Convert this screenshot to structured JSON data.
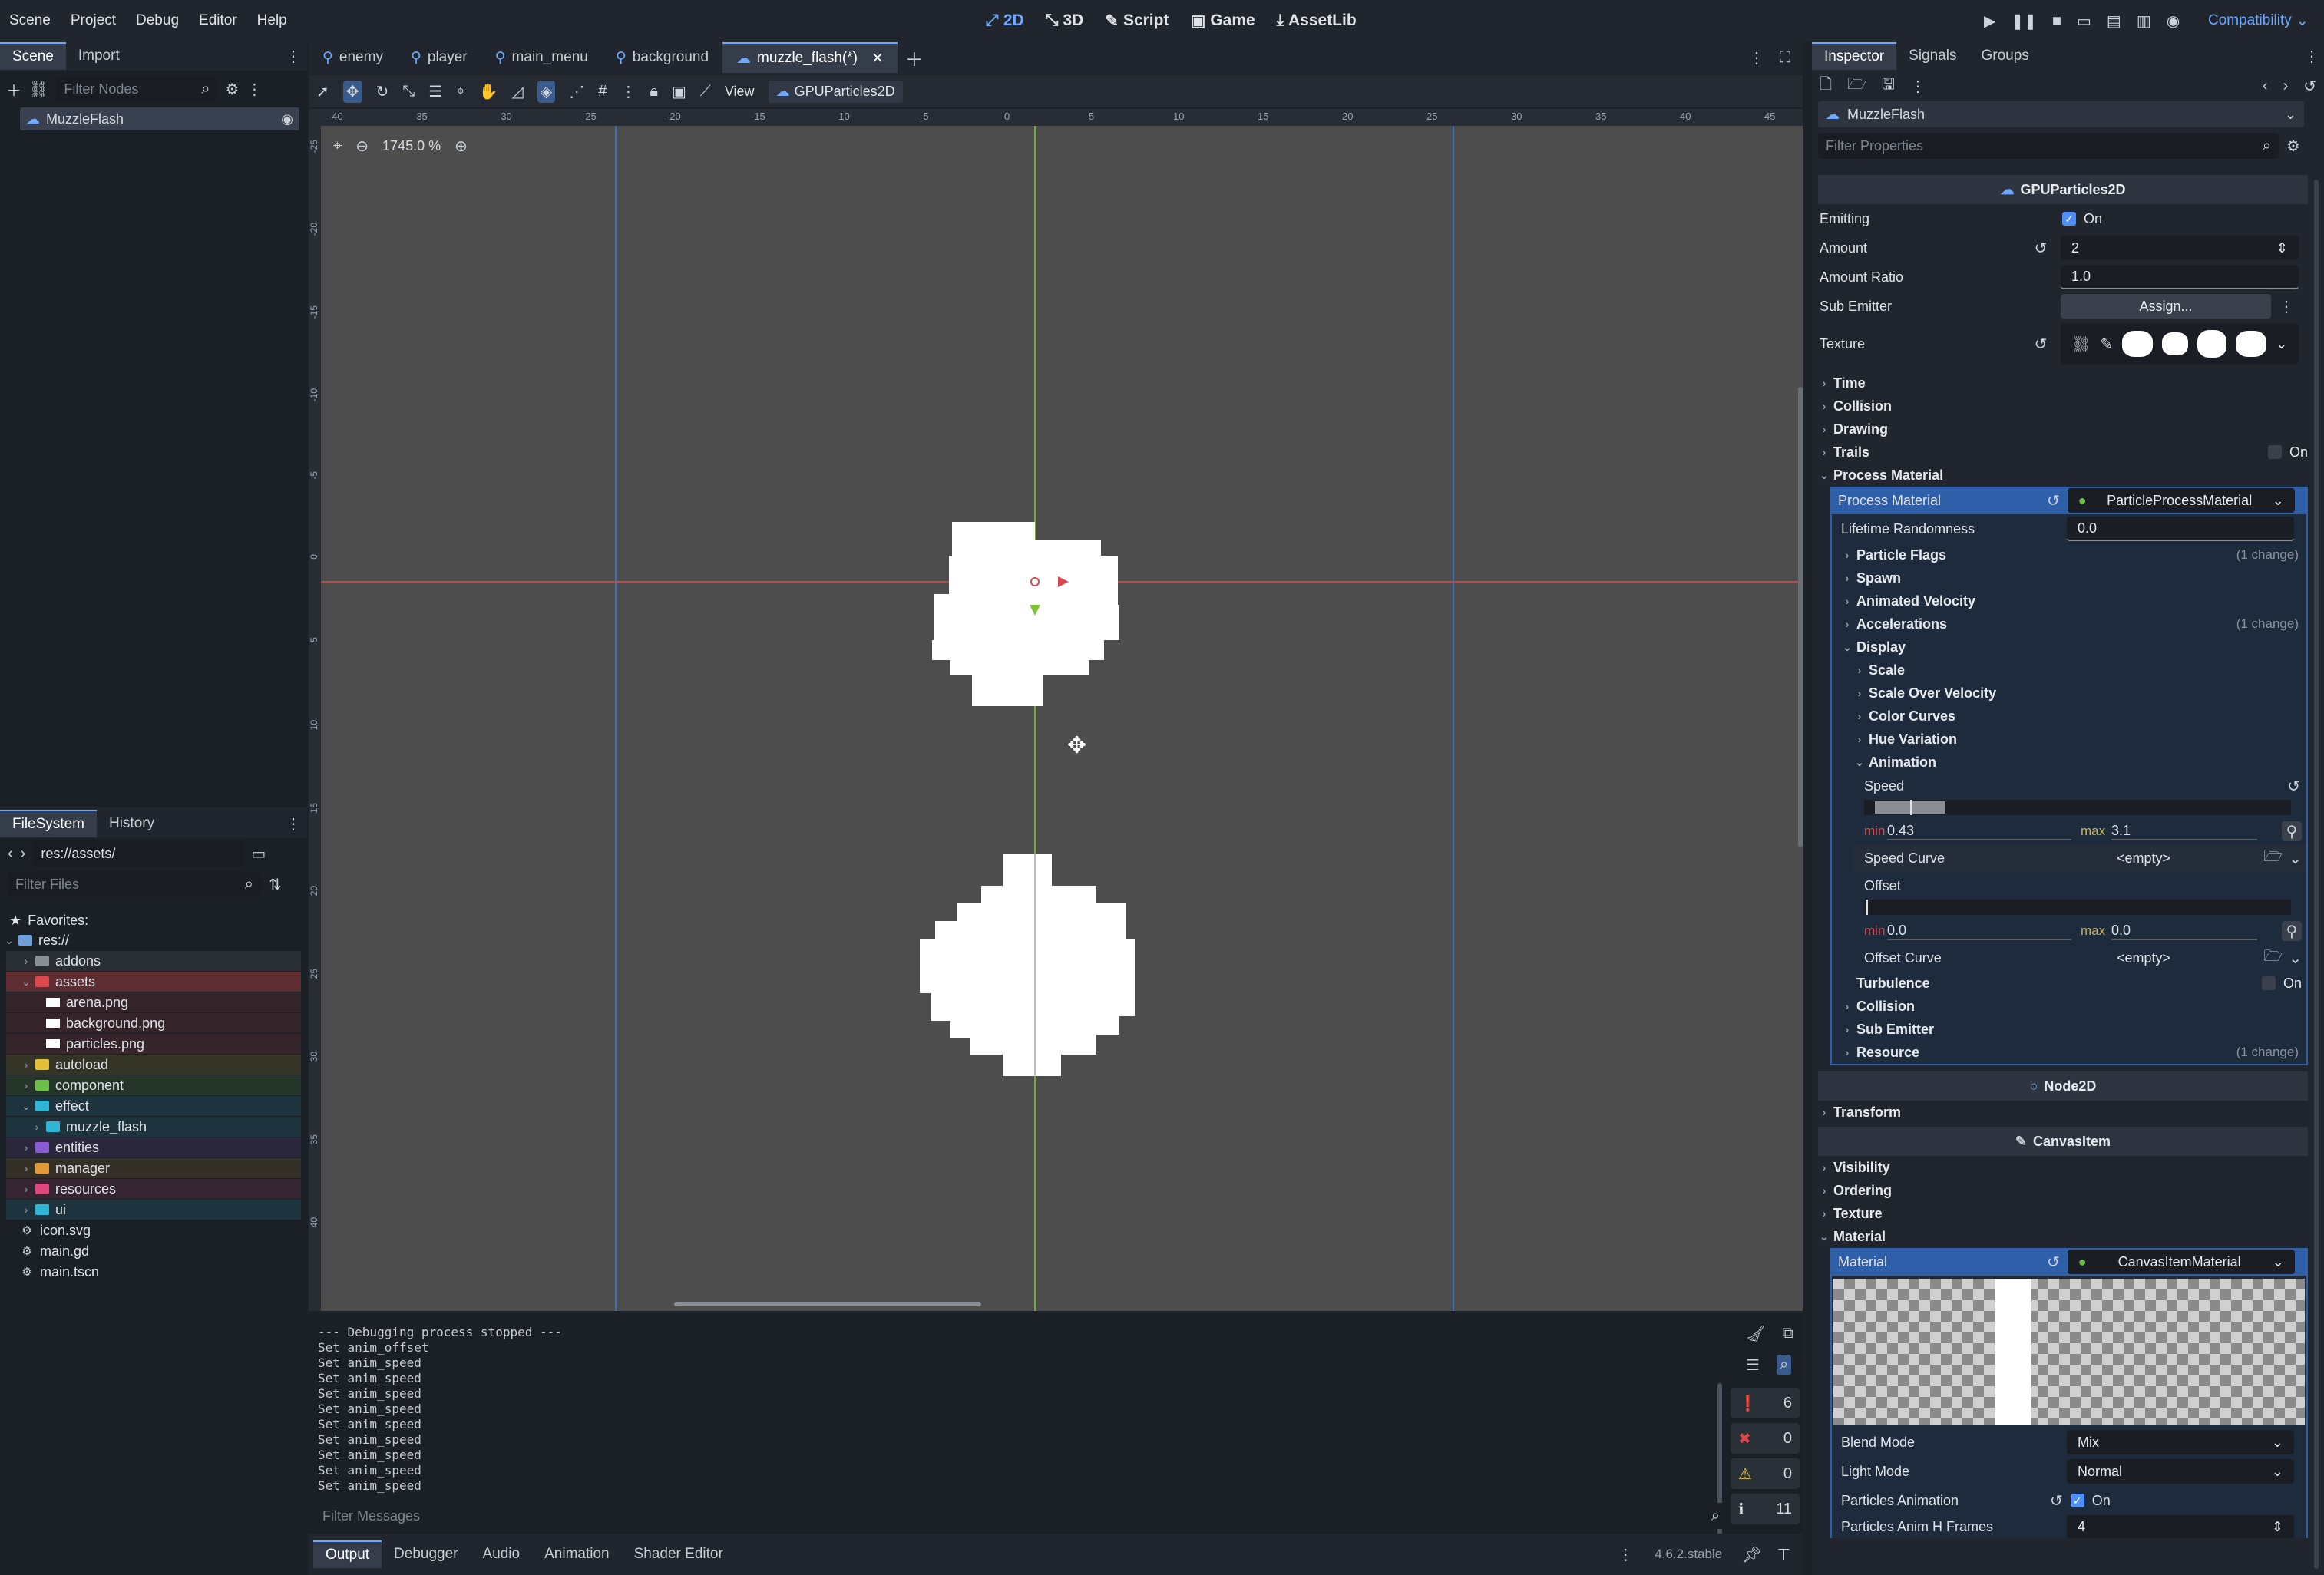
{
  "menu": [
    "Scene",
    "Project",
    "Debug",
    "Editor",
    "Help"
  ],
  "workspaces": [
    {
      "label": "2D",
      "active": true
    },
    {
      "label": "3D",
      "active": false
    },
    {
      "label": "Script",
      "active": false
    },
    {
      "label": "Game",
      "active": false
    },
    {
      "label": "AssetLib",
      "active": false
    }
  ],
  "renderer": "Compatibility",
  "scene_dock": {
    "tabs": [
      "Scene",
      "Import"
    ],
    "filter_placeholder": "Filter Nodes",
    "root_node": "MuzzleFlash"
  },
  "filesystem": {
    "tabs": [
      "FileSystem",
      "History"
    ],
    "path": "res://assets/",
    "filter_placeholder": "Filter Files",
    "favorites_label": "Favorites:",
    "root": "res://",
    "items": [
      {
        "name": "addons",
        "type": "folder",
        "color": "#8a8f96",
        "depth": 1,
        "expanded": false
      },
      {
        "name": "assets",
        "type": "folder",
        "color": "#e0474c",
        "depth": 1,
        "expanded": true,
        "selected": true
      },
      {
        "name": "arena.png",
        "type": "image",
        "depth": 2
      },
      {
        "name": "background.png",
        "type": "image",
        "depth": 2
      },
      {
        "name": "particles.png",
        "type": "image",
        "depth": 2
      },
      {
        "name": "autoload",
        "type": "folder",
        "color": "#e3c035",
        "depth": 1,
        "expanded": false
      },
      {
        "name": "component",
        "type": "folder",
        "color": "#6cc04a",
        "depth": 1,
        "expanded": false
      },
      {
        "name": "effect",
        "type": "folder",
        "color": "#2fb5d6",
        "depth": 1,
        "expanded": true
      },
      {
        "name": "muzzle_flash",
        "type": "folder",
        "color": "#2fb5d6",
        "depth": 2,
        "expanded": false
      },
      {
        "name": "entities",
        "type": "folder",
        "color": "#8b5bd6",
        "depth": 1,
        "expanded": false
      },
      {
        "name": "manager",
        "type": "folder",
        "color": "#e39a35",
        "depth": 1,
        "expanded": false
      },
      {
        "name": "resources",
        "type": "folder",
        "color": "#e0477d",
        "depth": 1,
        "expanded": false
      },
      {
        "name": "ui",
        "type": "folder",
        "color": "#2fb5d6",
        "depth": 1,
        "expanded": false
      },
      {
        "name": "icon.svg",
        "type": "file",
        "depth": 1
      },
      {
        "name": "main.gd",
        "type": "file",
        "depth": 1
      },
      {
        "name": "main.tscn",
        "type": "file",
        "depth": 1
      }
    ]
  },
  "scene_tabs": [
    {
      "label": "enemy",
      "active": false
    },
    {
      "label": "player",
      "active": false
    },
    {
      "label": "main_menu",
      "active": false
    },
    {
      "label": "background",
      "active": false
    },
    {
      "label": "muzzle_flash(*)",
      "active": true
    }
  ],
  "toolbar": {
    "view_label": "View",
    "node_label": "GPUParticles2D"
  },
  "viewport": {
    "zoom": "1745.0 %",
    "ruler_top": [
      "-40",
      "-35",
      "-30",
      "-25",
      "-20",
      "-15",
      "-10",
      "-5",
      "0",
      "5",
      "10",
      "15",
      "20",
      "25",
      "30",
      "35",
      "40",
      "45"
    ],
    "ruler_left": [
      "-25",
      "-20",
      "-15",
      "-10",
      "-5",
      "0",
      "5",
      "10",
      "15",
      "20",
      "25",
      "30",
      "35",
      "40"
    ]
  },
  "output": {
    "lines": [
      "--- Debugging process stopped ---",
      "Set anim_offset",
      "Set anim_speed",
      "Set anim_speed",
      "Set anim_speed",
      "Set anim_speed",
      "Set anim_speed",
      "Set anim_speed",
      "Set anim_speed",
      "Set anim_speed",
      "Set anim_speed"
    ],
    "counts": [
      "6",
      "0",
      "0",
      "11"
    ],
    "filter_placeholder": "Filter Messages",
    "tabs": [
      "Output",
      "Debugger",
      "Audio",
      "Animation",
      "Shader Editor"
    ],
    "version": "4.6.2.stable"
  },
  "inspector": {
    "tabs": [
      "Inspector",
      "Signals",
      "Groups"
    ],
    "node_name": "MuzzleFlash",
    "filter_placeholder": "Filter Properties",
    "class_header": "GPUParticles2D",
    "emitting_label": "Emitting",
    "emitting_value": "On",
    "amount_label": "Amount",
    "amount_value": "2",
    "amount_ratio_label": "Amount Ratio",
    "amount_ratio_value": "1.0",
    "sub_emitter_label": "Sub Emitter",
    "sub_emitter_button": "Assign...",
    "texture_label": "Texture",
    "sections": [
      "Time",
      "Collision",
      "Drawing"
    ],
    "trails_label": "Trails",
    "trails_value": "On",
    "process_material_section": "Process Material",
    "process_material_label": "Process Material",
    "process_material_value": "ParticleProcessMaterial",
    "lifetime_label": "Lifetime Randomness",
    "lifetime_value": "0.0",
    "pm_sections": [
      {
        "label": "Particle Flags",
        "change": "(1 change)"
      },
      {
        "label": "Spawn",
        "change": ""
      },
      {
        "label": "Animated Velocity",
        "change": ""
      },
      {
        "label": "Accelerations",
        "change": "(1 change)"
      }
    ],
    "display_label": "Display",
    "display_sections": [
      "Scale",
      "Scale Over Velocity",
      "Color Curves",
      "Hue Variation"
    ],
    "animation_label": "Animation",
    "speed_label": "Speed",
    "speed_min_label": "min",
    "speed_min": "0.43",
    "speed_max_label": "max",
    "speed_max": "3.1",
    "speed_curve_label": "Speed Curve",
    "speed_curve_value": "<empty>",
    "offset_label": "Offset",
    "offset_min_label": "min",
    "offset_min": "0.0",
    "offset_max_label": "max",
    "offset_max": "0.0",
    "offset_curve_label": "Offset Curve",
    "offset_curve_value": "<empty>",
    "turbulence_label": "Turbulence",
    "turbulence_value": "On",
    "pm_tail_sections": [
      {
        "label": "Collision",
        "change": ""
      },
      {
        "label": "Sub Emitter",
        "change": ""
      },
      {
        "label": "Resource",
        "change": "(1 change)"
      }
    ],
    "node2d_header": "Node2D",
    "transform_label": "Transform",
    "canvasitem_header": "CanvasItem",
    "ci_sections": [
      "Visibility",
      "Ordering",
      "Texture"
    ],
    "material_section": "Material",
    "material_label": "Material",
    "material_value": "CanvasItemMaterial",
    "blend_label": "Blend Mode",
    "blend_value": "Mix",
    "light_label": "Light Mode",
    "light_value": "Normal",
    "particles_anim_label": "Particles Animation",
    "particles_anim_value": "On",
    "anim_h_label": "Particles Anim H Frames",
    "anim_h_value": "4"
  }
}
